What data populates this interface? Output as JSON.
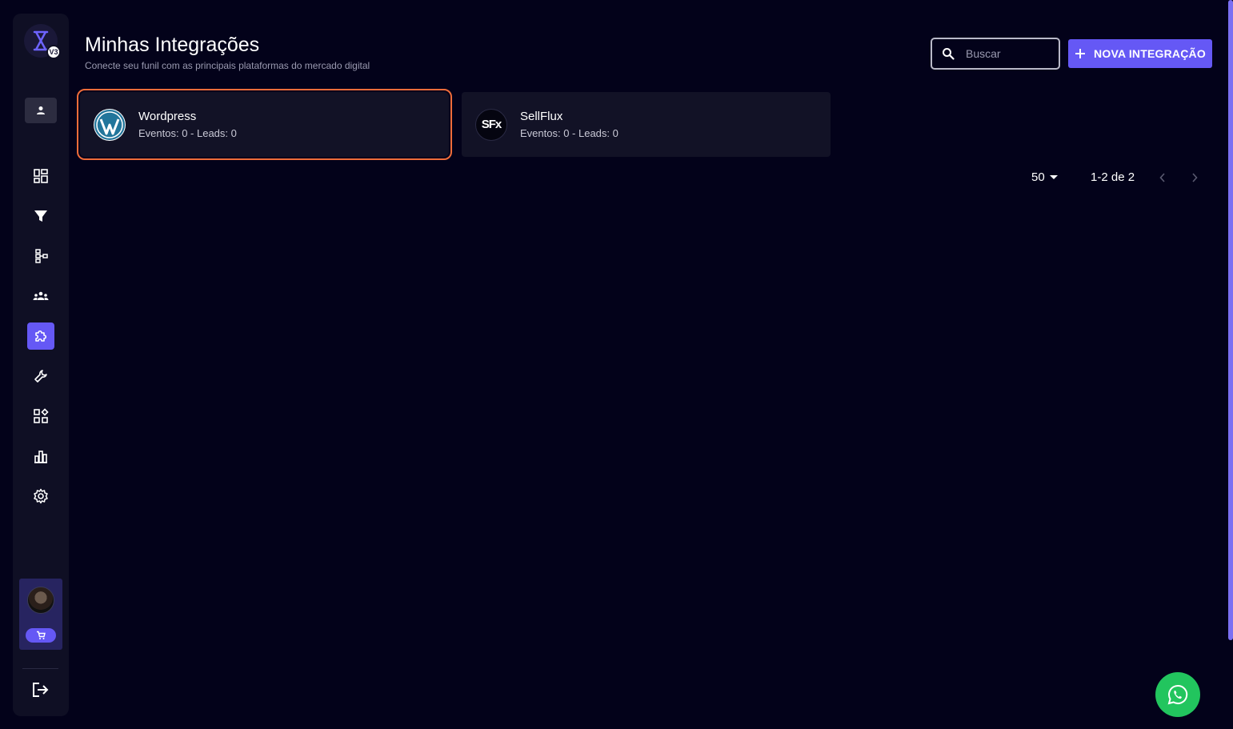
{
  "sidebar": {
    "logo_badge": "V3",
    "nav_items": [
      {
        "name": "dashboard",
        "icon": "dashboard-icon"
      },
      {
        "name": "funnels",
        "icon": "filter-icon"
      },
      {
        "name": "flows",
        "icon": "flowchart-icon"
      },
      {
        "name": "leads",
        "icon": "people-icon"
      },
      {
        "name": "integrations",
        "icon": "puzzle-icon",
        "active": true
      },
      {
        "name": "tools",
        "icon": "wrench-icon"
      },
      {
        "name": "apps",
        "icon": "apps-icon"
      },
      {
        "name": "reports",
        "icon": "bar-chart-icon"
      },
      {
        "name": "settings",
        "icon": "gear-icon"
      }
    ]
  },
  "header": {
    "title": "Minhas Integrações",
    "subtitle": "Conecte seu funil com as principais plataformas do mercado digital",
    "search_placeholder": "Buscar",
    "new_button_label": "NOVA INTEGRAÇÃO"
  },
  "integrations": [
    {
      "name": "Wordpress",
      "stats": "Eventos: 0 - Leads: 0",
      "icon": "wordpress-icon",
      "selected": true
    },
    {
      "name": "SellFlux",
      "stats": "Eventos: 0 - Leads: 0",
      "logo_text": "SFx",
      "icon": "sellflux-logo"
    }
  ],
  "pagination": {
    "per_page": "50",
    "range": "1-2 de 2"
  },
  "colors": {
    "background": "#03021a",
    "sidebar": "#0f0f24",
    "accent": "#6558f5",
    "selected_border": "#ef6c3a",
    "whatsapp": "#22c55e"
  }
}
